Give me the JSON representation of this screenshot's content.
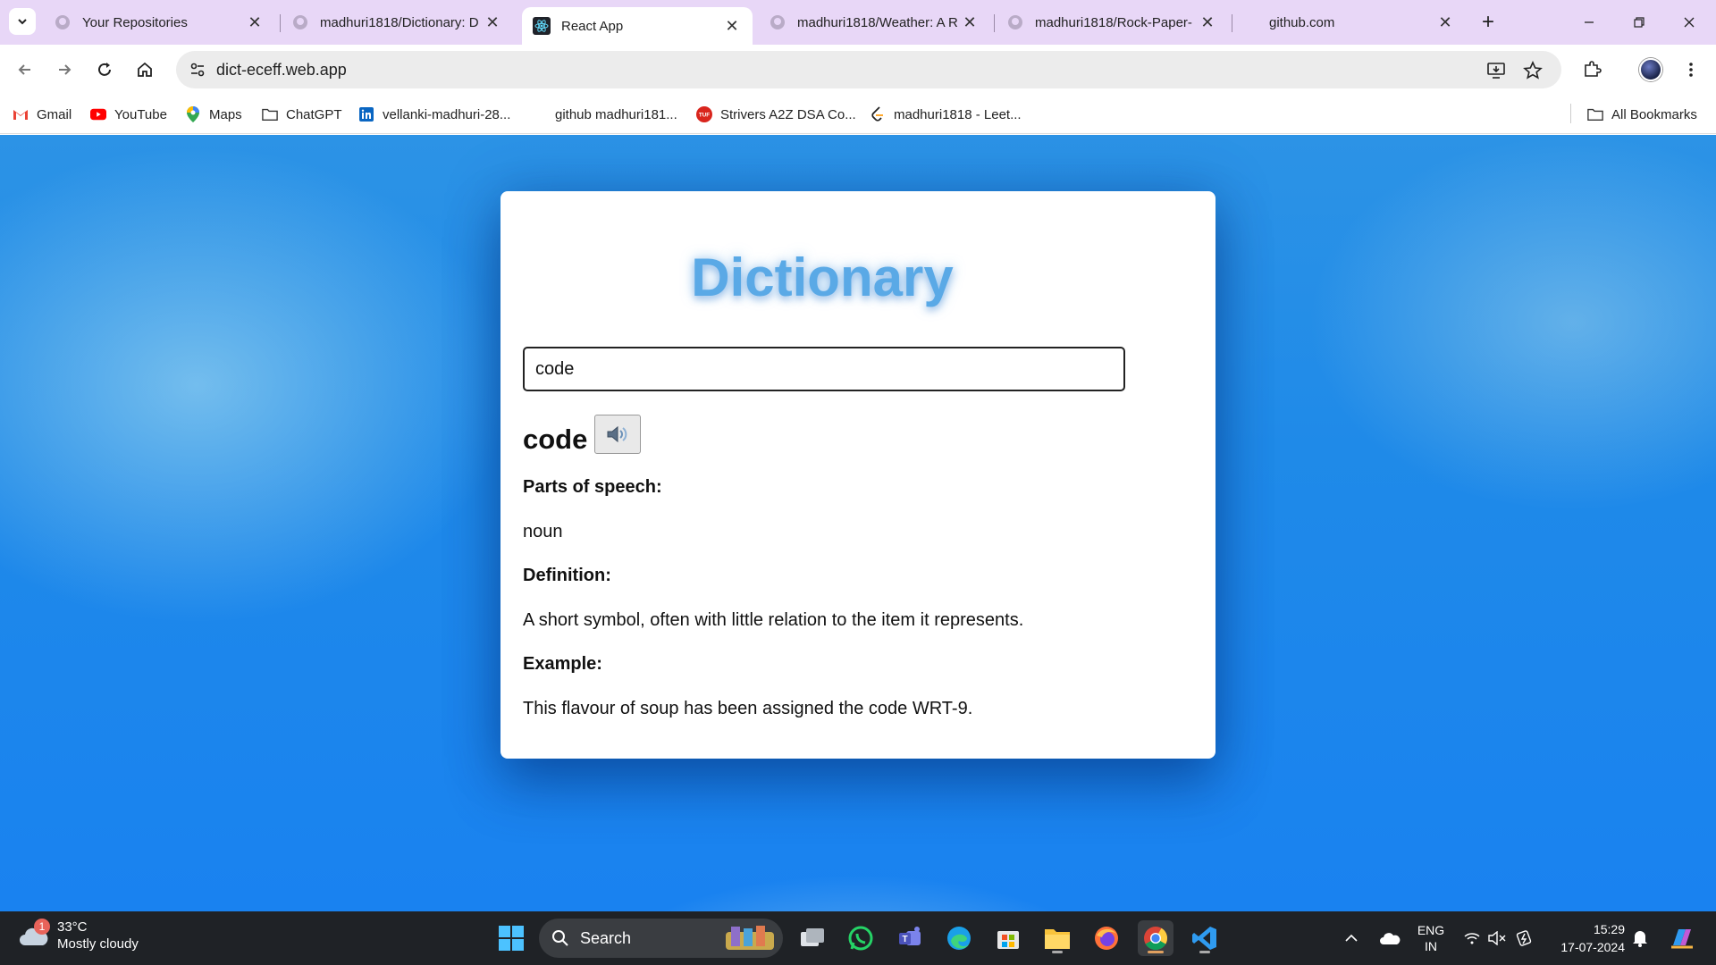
{
  "browser": {
    "tabs": [
      {
        "title": "Your Repositories",
        "icon": "github-icon"
      },
      {
        "title": "madhuri1818/Dictionary: D",
        "icon": "github-icon"
      },
      {
        "title": "React App",
        "icon": "react-icon"
      },
      {
        "title": "madhuri1818/Weather: A R",
        "icon": "github-icon"
      },
      {
        "title": "madhuri1818/Rock-Paper-",
        "icon": "github-icon"
      },
      {
        "title": "github.com",
        "icon": ""
      }
    ],
    "url": "dict-eceff.web.app",
    "bookmarks": [
      {
        "label": "Gmail",
        "icon": "gmail-icon"
      },
      {
        "label": "YouTube",
        "icon": "youtube-icon"
      },
      {
        "label": "Maps",
        "icon": "maps-icon"
      },
      {
        "label": "ChatGPT",
        "icon": "folder-icon"
      },
      {
        "label": "vellanki-madhuri-28...",
        "icon": "linkedin-icon"
      },
      {
        "label": "github madhuri181...",
        "icon": ""
      },
      {
        "label": "Strivers A2Z DSA Co...",
        "icon": "tuf-icon"
      },
      {
        "label": "madhuri1818 - Leet...",
        "icon": "leetcode-icon"
      },
      {
        "label": "All Bookmarks",
        "icon": "folder-icon"
      }
    ]
  },
  "app": {
    "title": "Dictionary",
    "search_value": "code",
    "word": "code",
    "speak_icon": "speaker-icon",
    "parts_label": "Parts of speech:",
    "parts_value": "noun",
    "definition_label": "Definition:",
    "definition_value": "A short symbol, often with little relation to the item it represents.",
    "example_label": "Example:",
    "example_value": "This flavour of soup has been assigned the code WRT-9."
  },
  "taskbar": {
    "weather_badge": "1",
    "weather_temp": "33°C",
    "weather_desc": "Mostly cloudy",
    "search_label": "Search",
    "lang_1": "ENG",
    "lang_2": "IN",
    "time": "15:29",
    "date": "17-07-2024"
  },
  "colors": {
    "title": "#5aa9e6",
    "tabstrip": "#e8d7f7",
    "page_bg": "#1f8ae8",
    "taskbar": "#1f2226"
  }
}
